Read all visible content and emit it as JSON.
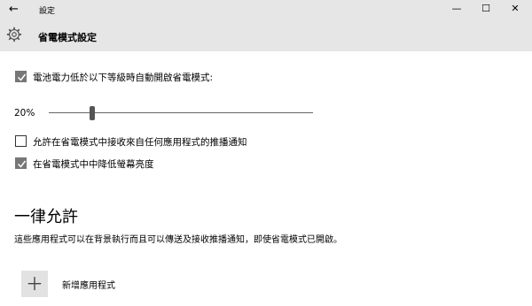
{
  "window": {
    "back_icon": "←",
    "title": "設定",
    "minimize_icon": "—",
    "maximize_icon": "☐",
    "close_icon": "✕"
  },
  "header": {
    "icon": "gear-icon",
    "title": "省電模式設定"
  },
  "settings": {
    "auto_enable": {
      "checked": true,
      "label": "電池電力低於以下等級時自動開啟省電模式:"
    },
    "threshold": {
      "value_label": "20%",
      "value": 20,
      "min": 0,
      "max": 100
    },
    "allow_push": {
      "checked": false,
      "label": "允許在省電模式中接收來自任何應用程式的推播通知"
    },
    "lower_brightness": {
      "checked": true,
      "label": "在省電模式中中降低螢幕亮度"
    }
  },
  "always_allowed": {
    "heading": "一律允許",
    "description": "這些應用程式可以在背景執行而且可以傳送及接收推播通知，即使省電模式已開啟。",
    "add_icon": "＋",
    "add_label": "新增應用程式"
  }
}
